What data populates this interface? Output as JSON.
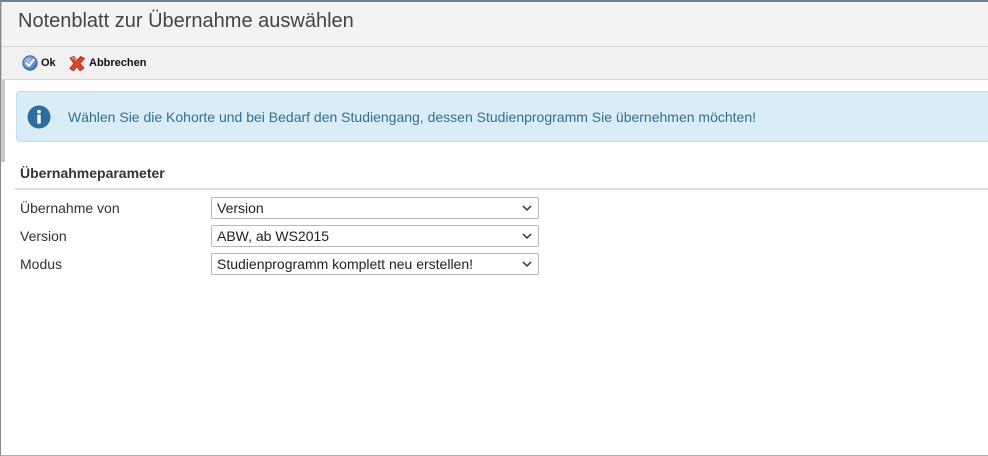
{
  "dialog": {
    "title": "Notenblatt zur Übernahme auswählen"
  },
  "toolbar": {
    "ok_label": "Ok",
    "ok_icon": "check-circle-icon",
    "cancel_label": "Abbrechen",
    "cancel_icon": "red-x-icon"
  },
  "info": {
    "icon": "info-icon",
    "text": "Wählen Sie die Kohorte und bei Bedarf den Studiengang, dessen Studienprogramm Sie übernehmen möchten!"
  },
  "section": {
    "heading": "Übernahmeparameter"
  },
  "form": {
    "fields": [
      {
        "label": "Übernahme von",
        "value": "Version"
      },
      {
        "label": "Version",
        "value": "ABW, ab WS2015"
      },
      {
        "label": "Modus",
        "value": "Studienprogramm komplett neu erstellen!"
      }
    ]
  },
  "colors": {
    "info_background": "#d9edf7",
    "info_text": "#31708f",
    "info_icon": "#2e6da4",
    "title_bar": "#f3f3f3"
  }
}
